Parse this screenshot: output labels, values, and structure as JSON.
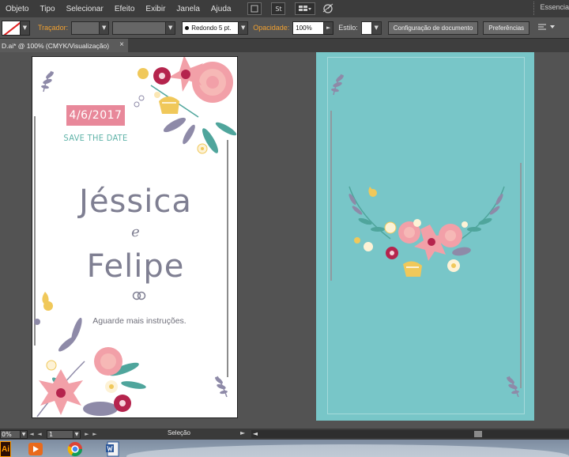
{
  "menubar": {
    "items": [
      "Objeto",
      "Tipo",
      "Selecionar",
      "Efeito",
      "Exibir",
      "Janela",
      "Ajuda"
    ],
    "st_icon": "St",
    "workspace": "Essencia"
  },
  "controlbar": {
    "stroke_label": "Traçador:",
    "brush": "Redondo 5 pt.",
    "opacity_label": "Opacidade:",
    "opacity_value": "100%",
    "style_label": "Estilo:",
    "doc_setup": "Configuração de documento",
    "preferences": "Preferências"
  },
  "tab": {
    "title": "D.ai* @ 100% (CMYK/Visualização)",
    "close": "×"
  },
  "artboard1": {
    "date": "4/6/2017",
    "save_the_date": "SAVE THE DATE",
    "name1": "Jéssica",
    "connector": "e",
    "name2": "Felipe",
    "instructions": "Aguarde mais instruções."
  },
  "statusbar": {
    "zoom": "0%",
    "page": "1",
    "status": "Seleção"
  },
  "colors": {
    "teal_background": "#78c6c8",
    "name_gray": "#7f7f92",
    "date_pink": "#e8889a",
    "save_date_teal": "#5fb3a8",
    "flower_pink": "#f2a0a8",
    "flower_burgundy": "#b5244d",
    "leaf_teal": "#4fa59c",
    "leaf_lavender": "#8e8aa8",
    "accent_yellow": "#f0c85a"
  }
}
